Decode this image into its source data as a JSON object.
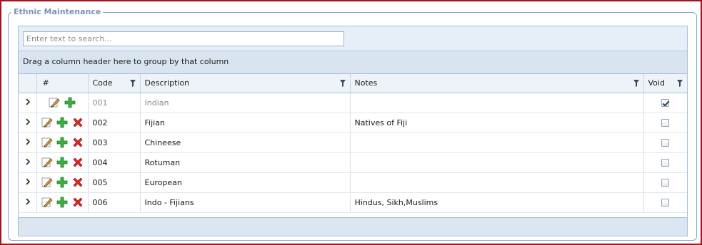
{
  "panel": {
    "title": "Ethnic Maintenance"
  },
  "search": {
    "placeholder": "Enter text to search..."
  },
  "group_panel": {
    "text": "Drag a column header here to group by that column"
  },
  "columns": {
    "hash": "#",
    "code": "Code",
    "description": "Description",
    "notes": "Notes",
    "void": "Void"
  },
  "rows": [
    {
      "code": "001",
      "description": "Indian",
      "notes": "",
      "void": true
    },
    {
      "code": "002",
      "description": "Fijian",
      "notes": "Natives of Fiji",
      "void": false
    },
    {
      "code": "003",
      "description": "Chineese",
      "notes": "",
      "void": false
    },
    {
      "code": "004",
      "description": "Rotuman",
      "notes": "",
      "void": false
    },
    {
      "code": "005",
      "description": "European",
      "notes": "",
      "void": false
    },
    {
      "code": "006",
      "description": "Indo - Fijians",
      "notes": "Hindus, Sikh,Muslims",
      "void": false
    }
  ],
  "icons": {
    "expander": "chevron-right-icon",
    "edit": "pencil-icon",
    "add": "plus-icon",
    "delete": "delete-x-icon",
    "filter": "filter-icon"
  },
  "colors": {
    "frame_border": "#a3141e",
    "header_bg": "#d9e4f1",
    "legend": "#7a93b4"
  }
}
